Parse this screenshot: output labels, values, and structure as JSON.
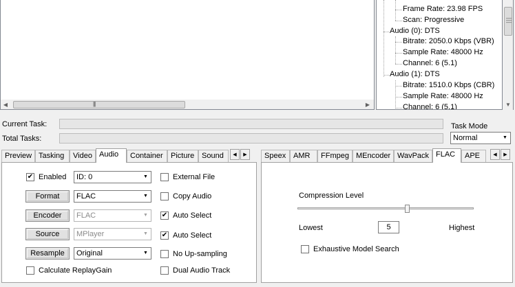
{
  "tree": {
    "nodes": [
      {
        "label": "Frame Rate: 23.98 FPS"
      },
      {
        "label": "Scan: Progressive"
      },
      {
        "label": "Audio (0): DTS"
      },
      {
        "label": "Bitrate: 2050.0 Kbps (VBR)"
      },
      {
        "label": "Sample Rate: 48000 Hz"
      },
      {
        "label": "Channel: 6 (5.1)"
      },
      {
        "label": "Audio (1): DTS"
      },
      {
        "label": "Bitrate: 1510.0 Kbps (CBR)"
      },
      {
        "label": "Sample Rate: 48000 Hz"
      },
      {
        "label": "Channel: 6 (5.1)"
      }
    ]
  },
  "progress": {
    "current_task_label": "Current Task:",
    "total_tasks_label": "Total Tasks:",
    "current_task_value": 0,
    "total_tasks_value": 0
  },
  "task_mode": {
    "label": "Task Mode",
    "value": "Normal"
  },
  "left_tabs": {
    "items": [
      "Preview",
      "Tasking",
      "Video",
      "Audio",
      "Container",
      "Picture",
      "Sound"
    ],
    "active": "Audio"
  },
  "audio": {
    "enabled_label": "Enabled",
    "enabled_checked": true,
    "id_value": "ID: 0",
    "format_button": "Format",
    "format_value": "FLAC",
    "encoder_button": "Encoder",
    "encoder_value": "FLAC",
    "source_button": "Source",
    "source_value": "MPlayer",
    "resample_button": "Resample",
    "resample_value": "Original",
    "replaygain_label": "Calculate ReplayGain",
    "replaygain_checked": false,
    "external_file_label": "External File",
    "external_file_checked": false,
    "copy_audio_label": "Copy Audio",
    "copy_audio_checked": false,
    "auto_select1_label": "Auto Select",
    "auto_select1_checked": true,
    "auto_select2_label": "Auto Select",
    "auto_select2_checked": true,
    "no_upsampling_label": "No Up-sampling",
    "no_upsampling_checked": false,
    "dual_audio_label": "Dual Audio Track",
    "dual_audio_checked": false
  },
  "right_tabs": {
    "items": [
      "Speex",
      "AMR",
      "FFmpeg",
      "MEncoder",
      "WavPack",
      "FLAC",
      "APE"
    ],
    "active": "FLAC"
  },
  "flac": {
    "compression_label": "Compression Level",
    "lowest_label": "Lowest",
    "highest_label": "Highest",
    "level_value": "5",
    "level_fraction": 0.625,
    "exhaustive_label": "Exhaustive Model Search",
    "exhaustive_checked": false
  },
  "icons": {
    "scroll_left": "◀",
    "scroll_right": "▶",
    "scroll_up": "▲",
    "scroll_down": "▼",
    "dropdown": "▼",
    "check": "✔"
  }
}
